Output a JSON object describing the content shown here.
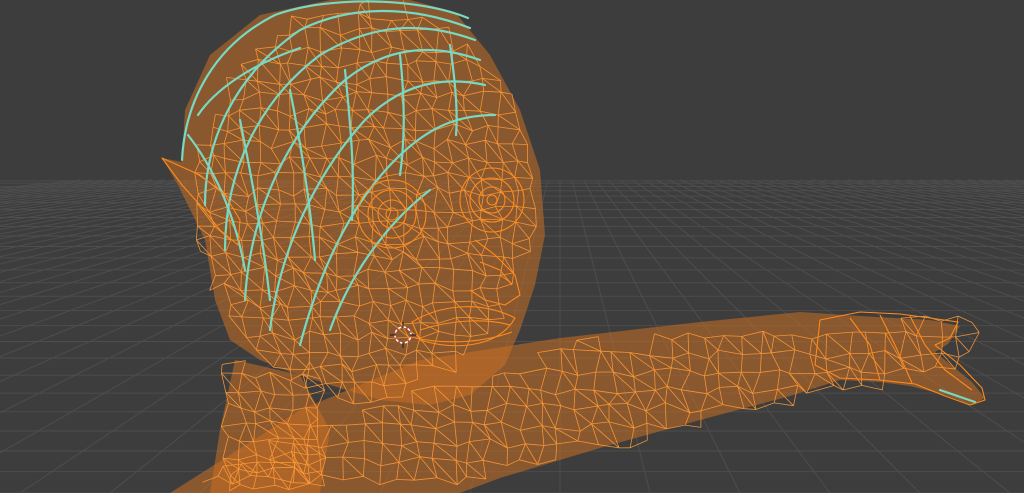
{
  "viewport": {
    "mode": "wireframe",
    "background_color": "#3d3d3d",
    "grid_color": "#4d4d4d",
    "wire_color": "#ff8a1c",
    "active_wire_color": "#78d8c2",
    "body_fill_color": "#c96f24"
  },
  "scene": {
    "subject": "character-mesh",
    "parts": [
      "head",
      "hair",
      "left-eye",
      "right-eye",
      "nose",
      "mouth",
      "ear",
      "neck",
      "arm",
      "hand"
    ]
  }
}
